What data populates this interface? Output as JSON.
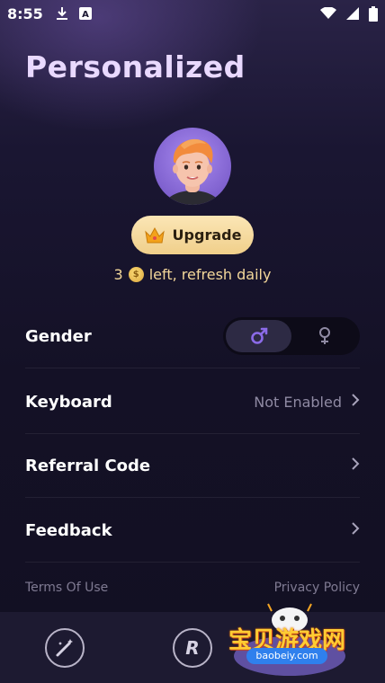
{
  "status_bar": {
    "time": "8:55",
    "left_icons": [
      "download-icon",
      "text-a-icon"
    ],
    "right_icons": [
      "wifi-icon",
      "signal-icon",
      "battery-icon"
    ]
  },
  "page": {
    "title": "Personalized"
  },
  "profile": {
    "avatar_icon": "avatar-3d-character",
    "upgrade_label": "Upgrade",
    "credits_count": "3",
    "credits_suffix": "left, refresh daily"
  },
  "settings": {
    "gender": {
      "label": "Gender",
      "options": [
        "male-icon",
        "female-icon"
      ],
      "selected": "male"
    },
    "keyboard": {
      "label": "Keyboard",
      "value": "Not Enabled"
    },
    "referral": {
      "label": "Referral Code"
    },
    "feedback": {
      "label": "Feedback"
    }
  },
  "links": {
    "terms": "Terms Of Use",
    "privacy": "Privacy Policy"
  },
  "bottom_nav": {
    "items": [
      "magic-wand-icon",
      "r-logo-icon"
    ]
  },
  "watermark": {
    "text": "宝贝游戏网",
    "url": "baobeiy.com"
  },
  "colors": {
    "accent_purple": "#8b6be8",
    "title_lavender": "#e9d9ff",
    "gold": "#f3d79a",
    "background": "#15122a"
  }
}
